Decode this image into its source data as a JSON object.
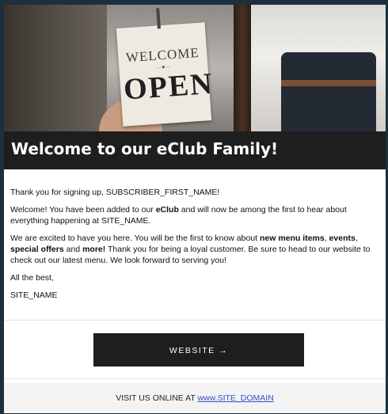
{
  "hero": {
    "sign_top": "WELCOME",
    "sign_main": "OPEN"
  },
  "title": "Welcome to our eClub Family!",
  "body": {
    "greeting": "Thank you for signing up, SUBSCRIBER_FIRST_NAME!",
    "p2_a": "Welcome! You have been added to our ",
    "p2_bold": "eClub",
    "p2_b": " and will now be among the first to hear about everything happening at SITE_NAME.",
    "p3_a": "We are excited to have you here. You will be the first to know about ",
    "p3_b1": "new menu items",
    "p3_c": ", ",
    "p3_b2": "events",
    "p3_d": ", ",
    "p3_b3": "special offers",
    "p3_e": " and ",
    "p3_b4": "more!",
    "p3_f": " Thank you for being a loyal customer. Be sure to head to our website to check out our latest menu. We look forward to serving you!",
    "signoff": "All the best,",
    "signature": "SITE_NAME"
  },
  "button": {
    "label": "WEBSITE →"
  },
  "footer": {
    "prefix": "VISIT US ONLINE AT ",
    "link": "www.SITE_DOMAIN"
  }
}
